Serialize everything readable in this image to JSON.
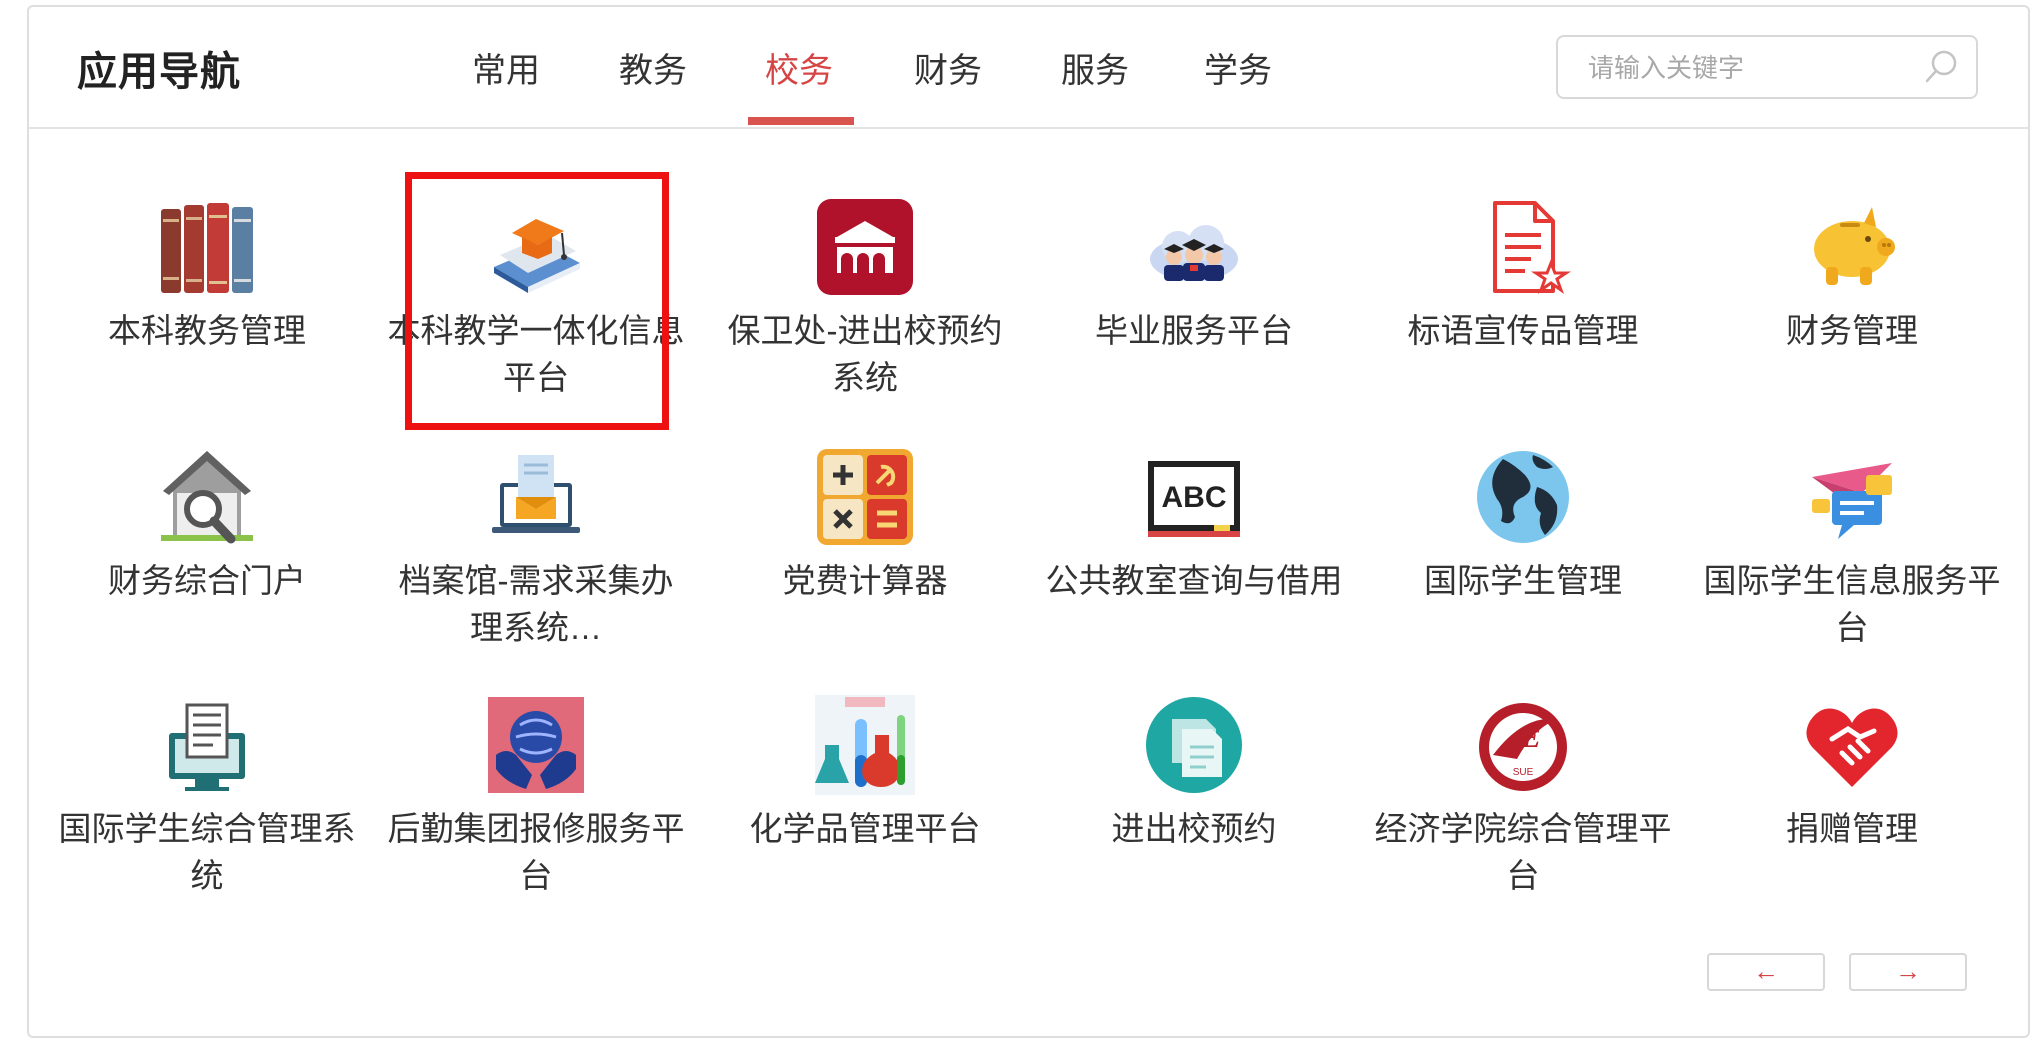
{
  "header": {
    "title": "应用导航",
    "tabs": [
      {
        "label": "常用"
      },
      {
        "label": "教务"
      },
      {
        "label": "校务",
        "active": true
      },
      {
        "label": "财务"
      },
      {
        "label": "服务"
      },
      {
        "label": "学务"
      }
    ],
    "search_placeholder": "请输入关键字"
  },
  "colors": {
    "accent": "#d64545",
    "highlight_border": "#ee1111"
  },
  "apps": [
    {
      "label": "本科教务管理",
      "icon": "books-icon"
    },
    {
      "label": "本科教学一体化信息平台",
      "icon": "graduation-cap-books-icon",
      "highlighted": true
    },
    {
      "label": "保卫处-进出校预约系统",
      "icon": "building-gate-icon"
    },
    {
      "label": "毕业服务平台",
      "icon": "graduates-cloud-icon"
    },
    {
      "label": "标语宣传品管理",
      "icon": "document-star-icon"
    },
    {
      "label": "财务管理",
      "icon": "piggy-bank-icon"
    },
    {
      "label": "财务综合门户",
      "icon": "house-search-icon"
    },
    {
      "label": "档案馆-需求采集办理系统…",
      "icon": "laptop-mail-icon"
    },
    {
      "label": "党费计算器",
      "icon": "calculator-icon"
    },
    {
      "label": "公共教室查询与借用",
      "icon": "abc-blackboard-icon"
    },
    {
      "label": "国际学生管理",
      "icon": "globe-icon"
    },
    {
      "label": "国际学生信息服务平台",
      "icon": "plane-chat-icon"
    },
    {
      "label": "国际学生综合管理系统",
      "icon": "computer-document-icon"
    },
    {
      "label": "后勤集团报修服务平台",
      "icon": "hands-globe-icon"
    },
    {
      "label": "化学品管理平台",
      "icon": "chemistry-flasks-icon"
    },
    {
      "label": "进出校预约",
      "icon": "copy-document-icon"
    },
    {
      "label": "经济学院综合管理平台",
      "icon": "economics-logo-icon"
    },
    {
      "label": "捐赠管理",
      "icon": "heart-handshake-icon"
    }
  ],
  "pager": {
    "prev": "←",
    "next": "→"
  }
}
